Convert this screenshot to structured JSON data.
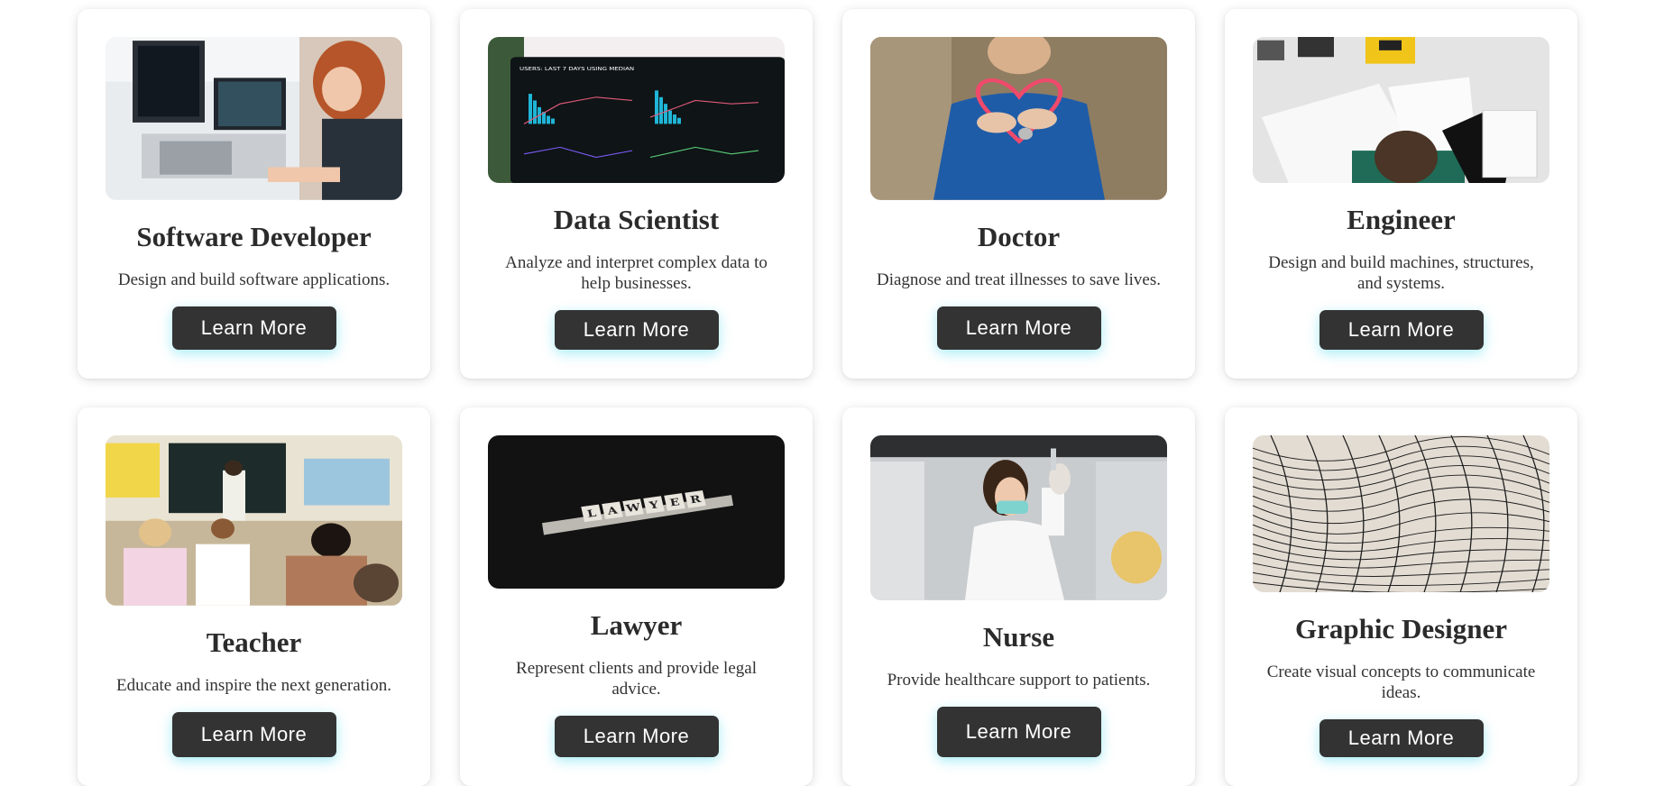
{
  "careers": [
    {
      "title": "Software Developer",
      "description": "Design and build software applications.",
      "button": "Learn More",
      "image": "office-coding-photo"
    },
    {
      "title": "Data Scientist",
      "description": "Analyze and interpret complex data to help businesses.",
      "button": "Learn More",
      "image": "analytics-dashboard-photo"
    },
    {
      "title": "Doctor",
      "description": "Diagnose and treat illnesses to save lives.",
      "button": "Learn More",
      "image": "stethoscope-heart-photo"
    },
    {
      "title": "Engineer",
      "description": "Design and build machines, structures, and systems.",
      "button": "Learn More",
      "image": "engineering-drawings-photo"
    },
    {
      "title": "Teacher",
      "description": "Educate and inspire the next generation.",
      "button": "Learn More",
      "image": "classroom-photo"
    },
    {
      "title": "Lawyer",
      "description": "Represent clients and provide legal advice.",
      "button": "Learn More",
      "image": "lawyer-tiles-photo"
    },
    {
      "title": "Nurse",
      "description": "Provide healthcare support to patients.",
      "button": "Learn More",
      "image": "nurse-lab-photo"
    },
    {
      "title": "Graphic Designer",
      "description": "Create visual concepts to communicate ideas.",
      "button": "Learn More",
      "image": "abstract-lines-photo"
    }
  ],
  "photo_text": {
    "dashboard_header": "USERS: LAST 7 DAYS USING MEDIAN",
    "lawyer_tiles": [
      "L",
      "A",
      "W",
      "Y",
      "E",
      "R"
    ]
  },
  "colors": {
    "button_bg": "#333333",
    "button_glow": "#00c8e6",
    "title": "#2b2b2b"
  }
}
